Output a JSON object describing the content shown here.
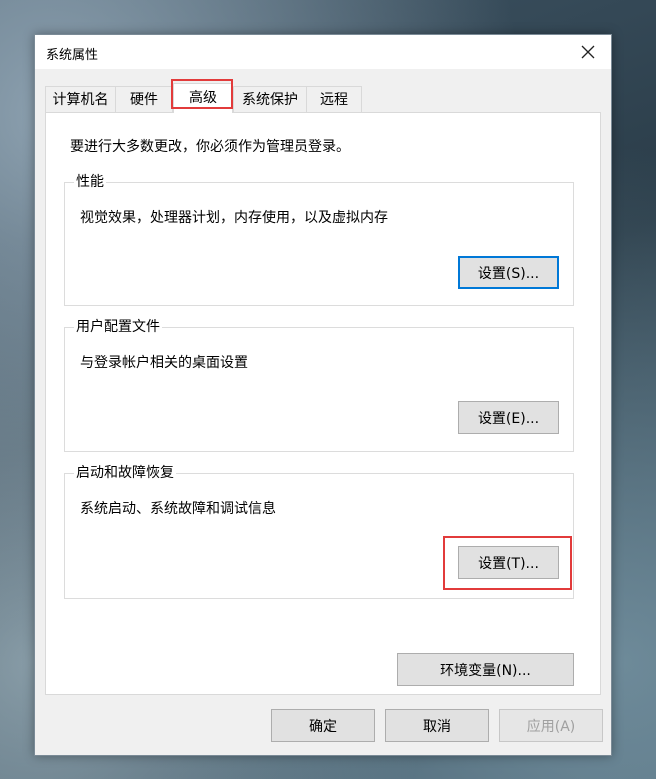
{
  "window": {
    "title": "系统属性"
  },
  "tabs": [
    {
      "label": "计算机名",
      "active": false
    },
    {
      "label": "硬件",
      "active": false
    },
    {
      "label": "高级",
      "active": true
    },
    {
      "label": "系统保护",
      "active": false
    },
    {
      "label": "远程",
      "active": false
    }
  ],
  "advanced": {
    "intro": "要进行大多数更改，你必须作为管理员登录。",
    "performance": {
      "title": "性能",
      "desc": "视觉效果，处理器计划，内存使用，以及虚拟内存",
      "button": "设置(S)..."
    },
    "user_profiles": {
      "title": "用户配置文件",
      "desc": "与登录帐户相关的桌面设置",
      "button": "设置(E)..."
    },
    "startup_recovery": {
      "title": "启动和故障恢复",
      "desc": "系统启动、系统故障和调试信息",
      "button": "设置(T)..."
    },
    "env_button": "环境变量(N)..."
  },
  "footer": {
    "ok": "确定",
    "cancel": "取消",
    "apply": "应用(A)",
    "apply_enabled": false
  },
  "annotations": {
    "highlight_color": "#e23b3b"
  }
}
